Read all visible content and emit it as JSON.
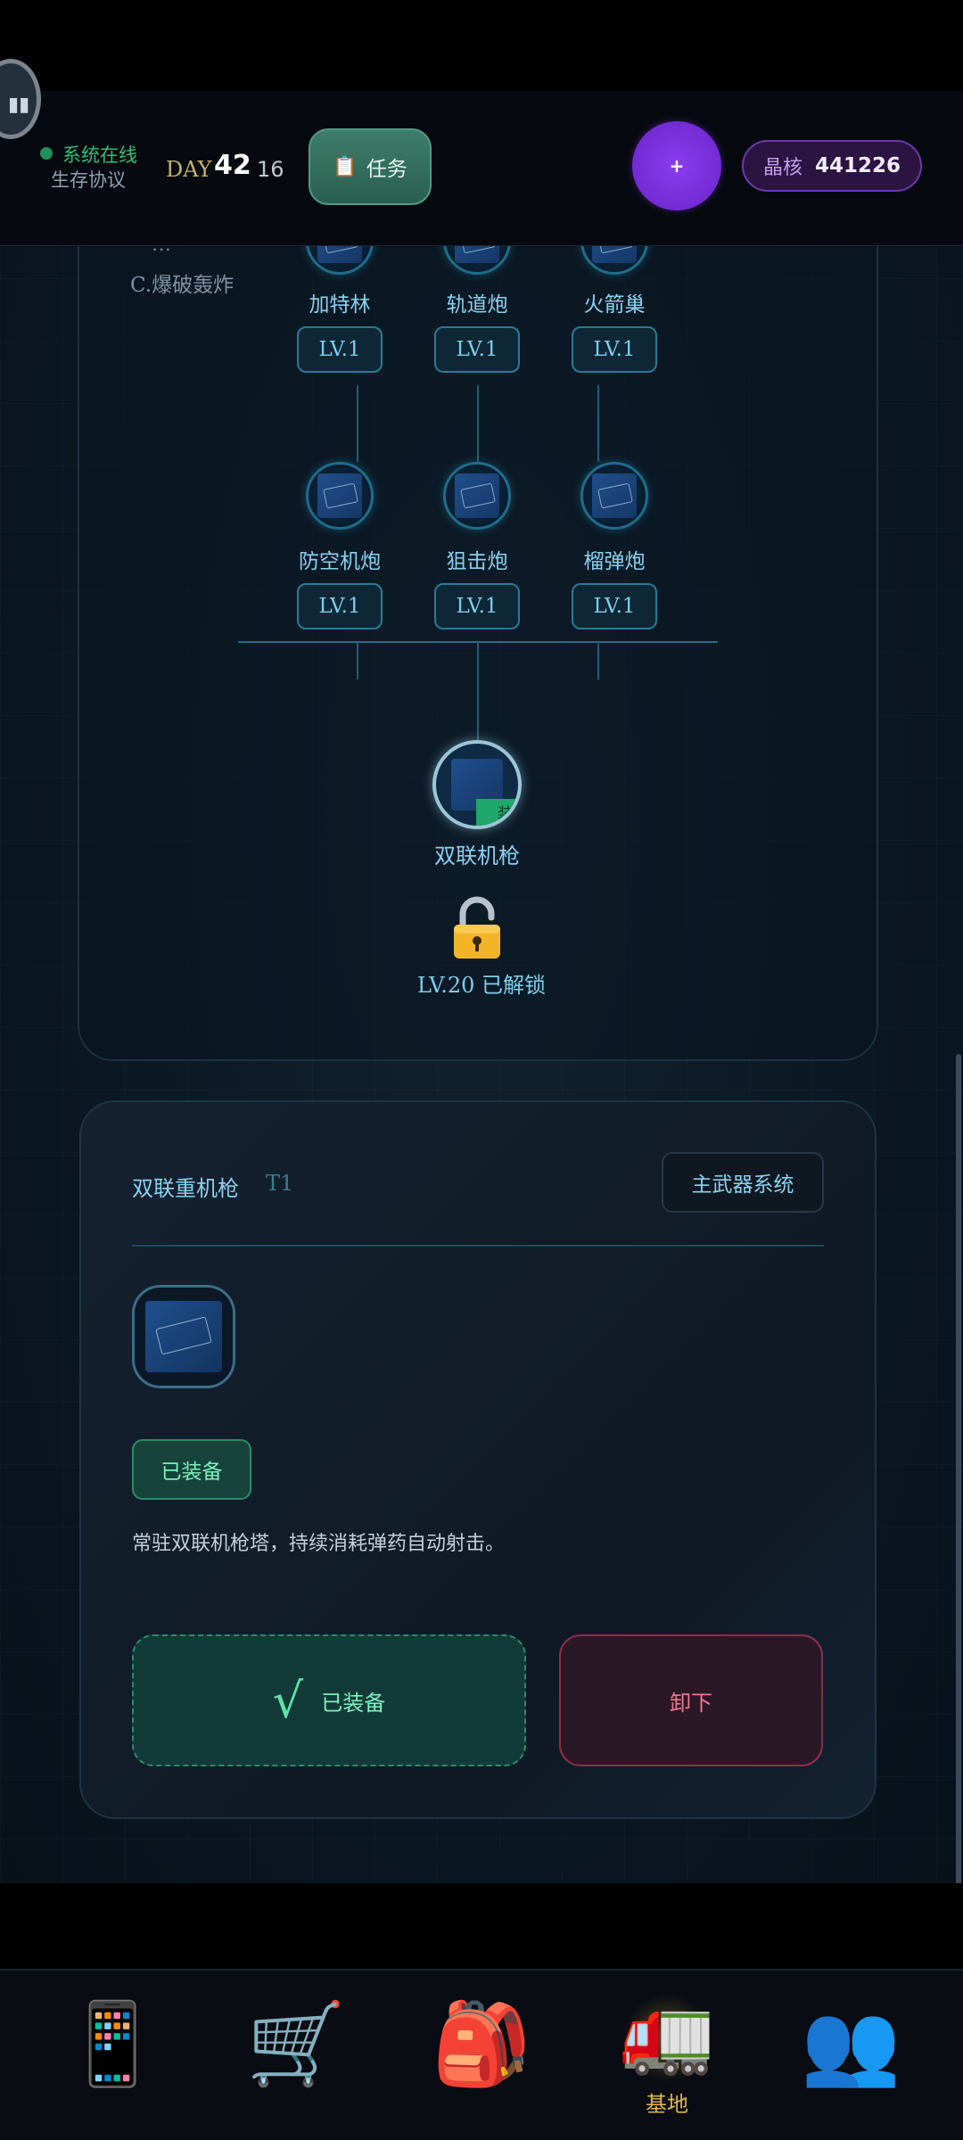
{
  "hud": {
    "status_online": "系统在线",
    "status_protocol": "生存协议",
    "day_label": "DAY",
    "day_number": "42",
    "day_sub": "16",
    "task_icon": "clipboard-icon",
    "task_label": "任务",
    "plus_label": "+",
    "crystal_label": "晶核",
    "crystal_value": "441226"
  },
  "tree": {
    "side_option_partial": "…",
    "side_option": "C.爆破轰炸",
    "row1": [
      {
        "name": "加特林",
        "level": "LV.1"
      },
      {
        "name": "轨道炮",
        "level": "LV.1"
      },
      {
        "name": "火箭巢",
        "level": "LV.1"
      }
    ],
    "row2": [
      {
        "name": "防空机炮",
        "level": "LV.1"
      },
      {
        "name": "狙击炮",
        "level": "LV.1"
      },
      {
        "name": "榴弹炮",
        "level": "LV.1"
      }
    ],
    "root": {
      "name": "双联机枪",
      "tag": "装"
    },
    "unlock_text": "LV.20 已解锁"
  },
  "detail": {
    "title": "双联重机枪",
    "tier": "T1",
    "system_button": "主武器系统",
    "equipped_tag": "已装备",
    "description": "常驻双联机枪塔，持续消耗弹药自动射击。",
    "equipped_button": "已装备",
    "equipped_check": "√",
    "unload_button": "卸下"
  },
  "nav": [
    {
      "icon": "phone-icon",
      "emoji": "📱",
      "label": ""
    },
    {
      "icon": "cart-icon",
      "emoji": "🛒",
      "label": ""
    },
    {
      "icon": "backpack-icon",
      "emoji": "🎒",
      "label": ""
    },
    {
      "icon": "truck-icon",
      "emoji": "🚛",
      "label": "基地"
    },
    {
      "icon": "people-icon",
      "emoji": "👥",
      "label": ""
    }
  ]
}
